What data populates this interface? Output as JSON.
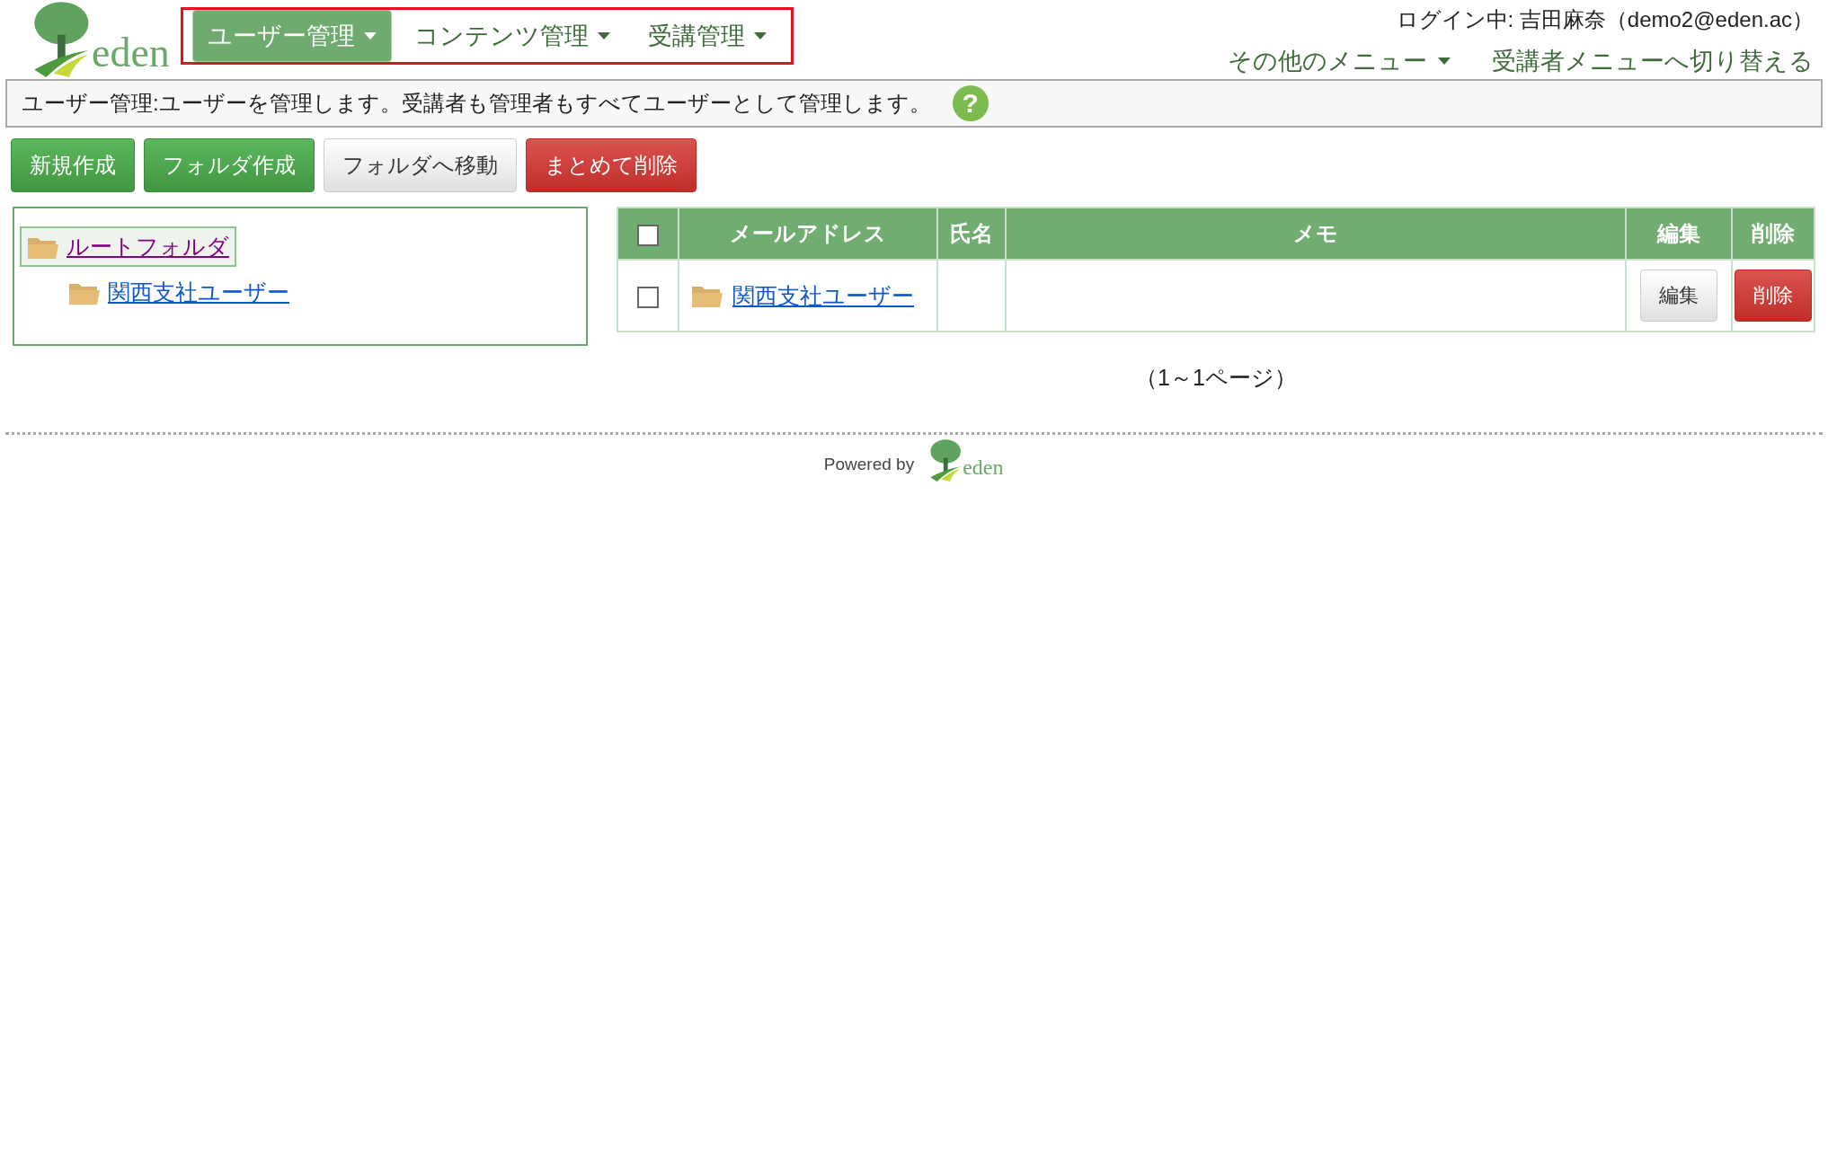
{
  "logo": {
    "text": "eden"
  },
  "nav": {
    "items": [
      {
        "label": "ユーザー管理",
        "selected": true
      },
      {
        "label": "コンテンツ管理",
        "selected": false
      },
      {
        "label": "受講管理",
        "selected": false
      }
    ]
  },
  "account": {
    "login": "ログイン中: 吉田麻奈（demo2@eden.ac）",
    "links": [
      {
        "label": "その他のメニュー",
        "dropdown": true
      },
      {
        "label": "受講者メニューへ切り替える",
        "dropdown": false
      }
    ]
  },
  "description": {
    "text": "ユーザー管理:ユーザーを管理します。受講者も管理者もすべてユーザーとして管理します。",
    "help": "?"
  },
  "toolbar": [
    {
      "label": "新規作成",
      "kind": "primary"
    },
    {
      "label": "フォルダ作成",
      "kind": "primary"
    },
    {
      "label": "フォルダへ移動",
      "kind": "default"
    },
    {
      "label": "まとめて削除",
      "kind": "danger"
    }
  ],
  "tree": {
    "label": "ルートフォルダ",
    "selected": true,
    "children": [
      {
        "label": "関西支社ユーザー",
        "selected": false
      }
    ]
  },
  "table": {
    "select_all": {
      "checked": false
    },
    "columns": [
      "メールアドレス",
      "氏名",
      "メモ",
      "編集",
      "削除"
    ],
    "rows": [
      {
        "checked": false,
        "kind": "folder",
        "link": "関西支社ユーザー",
        "edit": "編集",
        "delete": "削除"
      }
    ]
  },
  "pagination": "（1～1ページ）",
  "footer": {
    "powered": "Powered by",
    "logo": "eden"
  }
}
